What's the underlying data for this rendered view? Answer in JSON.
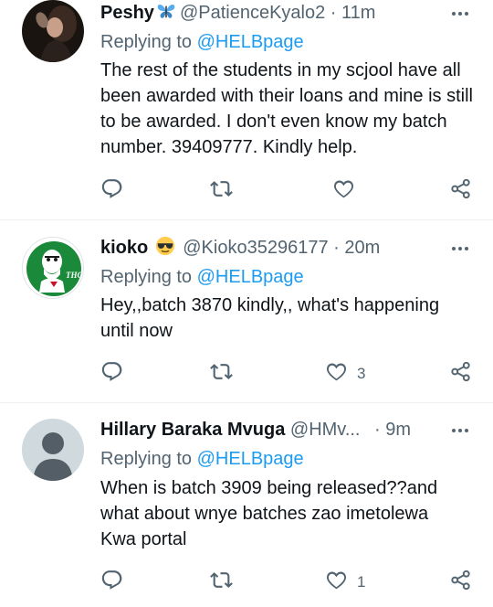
{
  "tweets": [
    {
      "name": "Peshy",
      "handle": "@PatienceKyalo2",
      "dot": "·",
      "time": "11m",
      "replying_prefix": "Replying to",
      "replying_to": "@HELBpage",
      "text": "The rest of the students in my scjool have all been awarded with their loans and mine is still to be awarded. I don't even know my batch number. 39409777. Kindly help.",
      "likes": ""
    },
    {
      "name": "kioko",
      "handle": "@Kioko35296177",
      "dot": "·",
      "time": "20m",
      "replying_prefix": "Replying to",
      "replying_to": "@HELBpage",
      "text": "Hey,,batch 3870 kindly,, what's happening until now",
      "likes": "3",
      "avatar_text": "THC"
    },
    {
      "name": "Hillary Baraka Mvuga",
      "handle": "@HMv...",
      "dot": "·",
      "time": "9m",
      "replying_prefix": "Replying to",
      "replying_to": "@HELBpage",
      "text": "When is batch 3909 being released??and what about wnye batches zao imetolewa Kwa portal",
      "likes": "1"
    }
  ],
  "colors": {
    "text": "#0f1419",
    "secondary": "#536471",
    "link": "#1d9bf0",
    "border": "#eff3f4"
  },
  "icons": {
    "more": "more-icon",
    "reply": "reply-icon",
    "retweet": "retweet-icon",
    "like": "like-icon",
    "share": "share-icon",
    "butterfly": "butterfly-emoji",
    "sunglasses": "sunglasses-emoji"
  }
}
